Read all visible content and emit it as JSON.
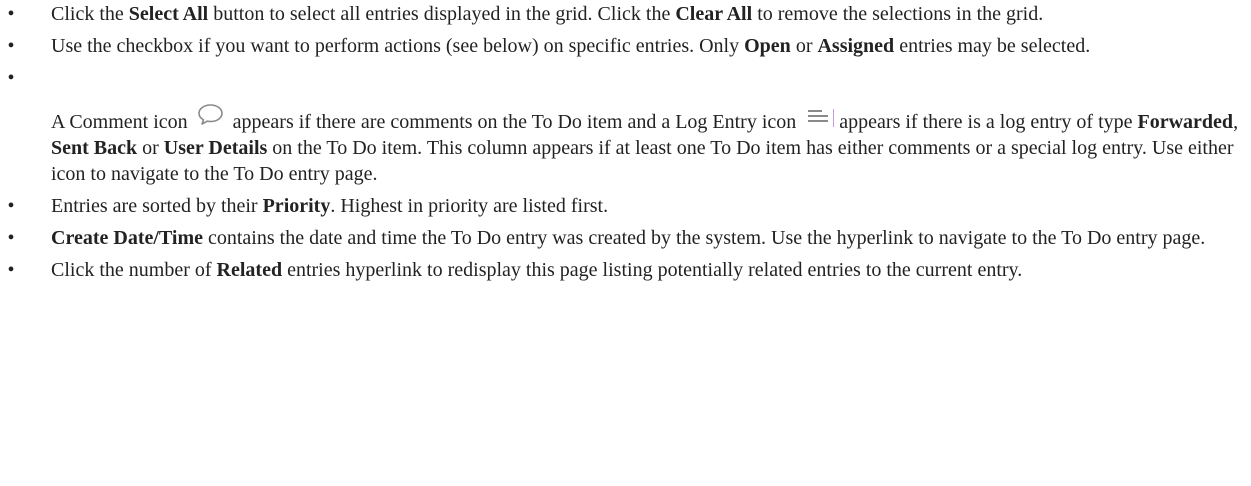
{
  "bullet_char": "•",
  "items": [
    {
      "parts": [
        "Click the ",
        "Select All",
        " button to select all entries displayed in the grid. Click the ",
        "Clear All",
        " to remove the selections in the grid."
      ]
    },
    {
      "parts": [
        "Use the checkbox if you want to perform actions (see below) on specific entries. Only ",
        "Open",
        " or ",
        "Assigned",
        " entries may be selected."
      ]
    },
    {
      "parts": [
        "A Comment icon",
        "appears if there are comments on the To Do item and a Log Entry icon",
        "appears if there is a log entry of type ",
        "Forwarded",
        ", ",
        "Sent Back",
        " or ",
        "User Details",
        " on the To Do item. This column appears if at least one To Do item has either comments or a special log entry. Use either icon to navigate to the To Do entry page."
      ]
    },
    {
      "parts": [
        "Entries are sorted by their ",
        "Priority",
        ". Highest in priority are listed first."
      ]
    },
    {
      "parts": [
        "Create Date/Time",
        " contains the date and time the To Do entry was created by the system. Use the hyperlink to navigate to the To Do entry page."
      ]
    },
    {
      "parts": [
        "Click the number of ",
        "Related",
        " entries hyperlink to redisplay this page listing potentially related entries to the current entry."
      ]
    }
  ],
  "icons": {
    "comment": "comment-bubble-icon",
    "log": "log-entry-lines-icon"
  },
  "colors": {
    "text": "#222222",
    "icon": "#8a8a8a",
    "accent_mark": "#c49ad8"
  }
}
